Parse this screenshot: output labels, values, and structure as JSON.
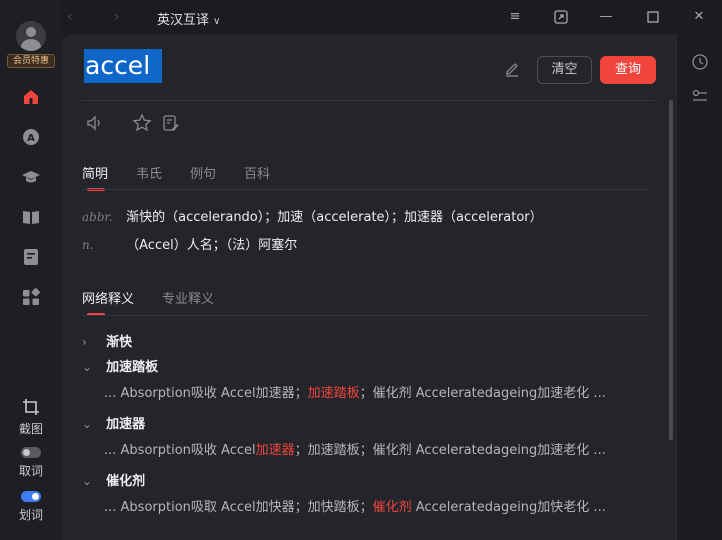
{
  "sidebar": {
    "vip_badge": "会员特惠",
    "icons": [
      "home-icon",
      "ai-translate-icon",
      "study-icon",
      "wordbook-icon",
      "document-icon",
      "apps-icon"
    ],
    "bottom_tools": [
      {
        "label": "截图",
        "icon": "crop-icon"
      },
      {
        "label": "取词",
        "toggle": "off"
      },
      {
        "label": "划词",
        "toggle": "on"
      }
    ]
  },
  "titlebar": {
    "mode": "英汉互译",
    "mode_chevron": "∨"
  },
  "search": {
    "query": "accel",
    "clear_label": "清空",
    "query_label": "查询"
  },
  "tabs": {
    "items": [
      "简明",
      "韦氏",
      "例句",
      "百科"
    ],
    "active": "简明"
  },
  "definitions": [
    {
      "pos": "abbr.",
      "text": "渐快的（accelerando）；加速（accelerate）；加速器（accelerator）"
    },
    {
      "pos": "n.",
      "text": "（Accel）人名；（法）阿塞尔"
    }
  ],
  "web_tabs": {
    "items": [
      "网络释义",
      "专业释义"
    ],
    "active": "网络释义"
  },
  "web_meanings": [
    {
      "term": "渐快",
      "expanded": false
    },
    {
      "term": "加速踏板",
      "expanded": true,
      "example": {
        "pre": "... Absorption吸收 Accel加速器；",
        "hl": "加速踏板",
        "post": "；催化剂 Acceleratedageing加速老化 ..."
      }
    },
    {
      "term": "加速器",
      "expanded": true,
      "example": {
        "pre": "... Absorption吸收 Accel",
        "hl": "加速器",
        "post": "；加速踏板；催化剂 Acceleratedageing加速老化 ..."
      }
    },
    {
      "term": "催化剂",
      "expanded": true,
      "example": {
        "pre": "... Absorption吸取 Accel加快器；加快踏板；",
        "hl": "催化剂",
        "post": " Acceleratedageing加快老化 ..."
      }
    }
  ],
  "colors": {
    "accent": "#f0453d",
    "selection": "#0e67c8",
    "panel": "#23252b",
    "toggle_on": "#3f7cf0"
  }
}
